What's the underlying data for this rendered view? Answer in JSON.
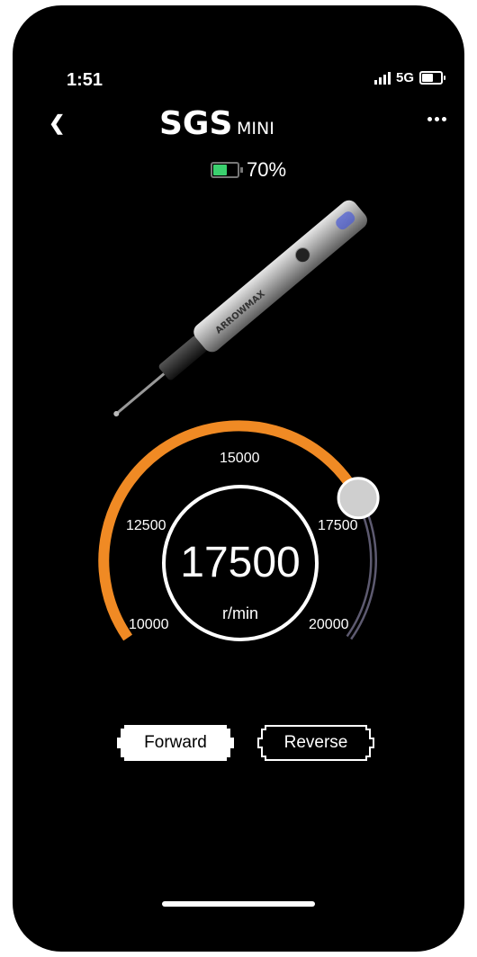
{
  "status_bar": {
    "time": "1:51",
    "network": "5G"
  },
  "header": {
    "brand_main": "SGS",
    "brand_sub": "MINI"
  },
  "battery": {
    "percent": "70%",
    "level": 0.7,
    "color": "#3bd16f"
  },
  "product": {
    "engraving": "ARROWMAX"
  },
  "gauge": {
    "ticks": [
      "10000",
      "12500",
      "15000",
      "17500",
      "20000"
    ],
    "min": 10000,
    "max": 20000,
    "current": 17500,
    "value_label": "17500",
    "unit": "r/min",
    "accent": "#f08a24",
    "track": "#5d5a70"
  },
  "direction": {
    "forward_label": "Forward",
    "reverse_label": "Reverse",
    "selected": "Forward"
  }
}
